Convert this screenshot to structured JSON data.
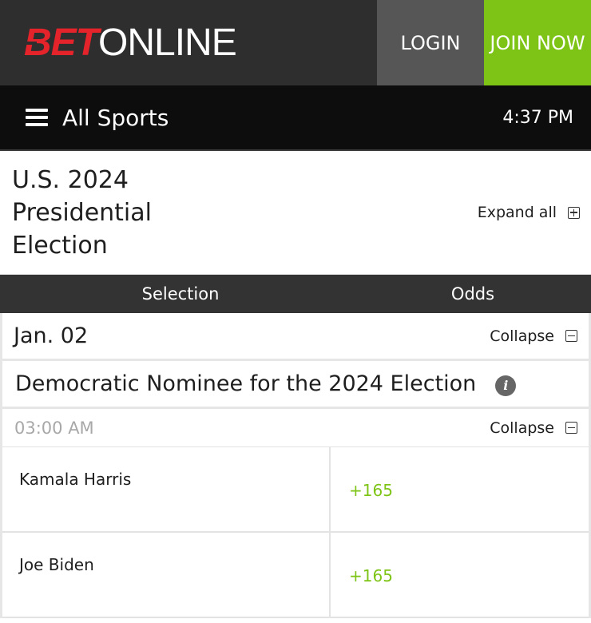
{
  "header": {
    "logo_bet": "BET",
    "logo_online": "ONLINE",
    "login_label": "LOGIN",
    "join_label": "JOIN NOW"
  },
  "nav": {
    "title": "All Sports",
    "time": "4:37 PM"
  },
  "event": {
    "title": "U.S. 2024 Presidential Election",
    "expand_all_label": "Expand all"
  },
  "columns": {
    "selection": "Selection",
    "odds": "Odds"
  },
  "schedule": {
    "date": "Jan. 02",
    "collapse_label": "Collapse",
    "market_title": "Democratic Nominee for the 2024 Election",
    "info_icon": "i",
    "time": "03:00 AM",
    "time_collapse_label": "Collapse"
  },
  "selections": [
    {
      "name": "Kamala Harris",
      "odds": "+165"
    },
    {
      "name": "Joe Biden",
      "odds": "+165"
    }
  ],
  "colors": {
    "brand_red": "#e5232b",
    "accent_green": "#7ec416",
    "header_dark": "#2e2e2e",
    "nav_black": "#0d0d0d"
  },
  "icons": [
    "hamburger-menu-icon",
    "expand-plus-icon",
    "collapse-minus-icon",
    "info-icon"
  ]
}
